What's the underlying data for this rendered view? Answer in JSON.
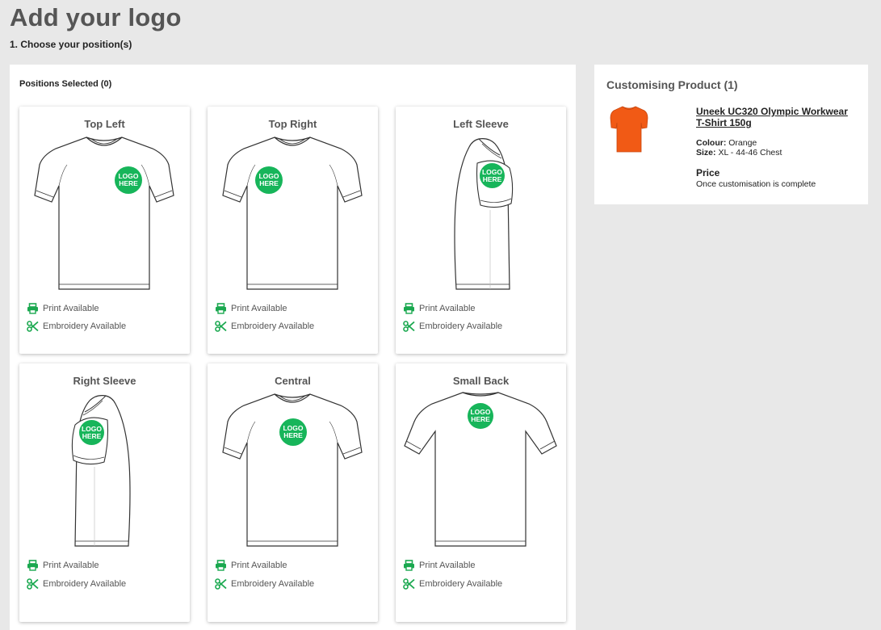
{
  "header": {
    "title": "Add your logo",
    "step": "1. Choose your position(s)"
  },
  "positions": {
    "heading": "Positions Selected (0)",
    "logo_text_line1": "LOGO",
    "logo_text_line2": "HERE",
    "print_label": "Print Available",
    "embroidery_label": "Embroidery Available",
    "items": [
      {
        "title": "Top Left",
        "view": "front"
      },
      {
        "title": "Top Right",
        "view": "front"
      },
      {
        "title": "Left Sleeve",
        "view": "side"
      },
      {
        "title": "Right Sleeve",
        "view": "side"
      },
      {
        "title": "Central",
        "view": "front"
      },
      {
        "title": "Small Back",
        "view": "back"
      }
    ]
  },
  "product": {
    "heading": "Customising Product (1)",
    "name": "Uneek UC320 Olympic Workwear T-Shirt 150g",
    "colour_label": "Colour:",
    "colour_value": "Orange",
    "size_label": "Size:",
    "size_value": "XL - 44-46 Chest",
    "price_label": "Price",
    "price_note": "Once customisation is complete",
    "shirt_color": "#f15a15"
  },
  "colors": {
    "accent_green": "#17b55a",
    "icon_green": "#1aa84f",
    "page_bg": "#e8e8e8"
  },
  "icons": [
    "printer-icon",
    "scissors-icon"
  ]
}
